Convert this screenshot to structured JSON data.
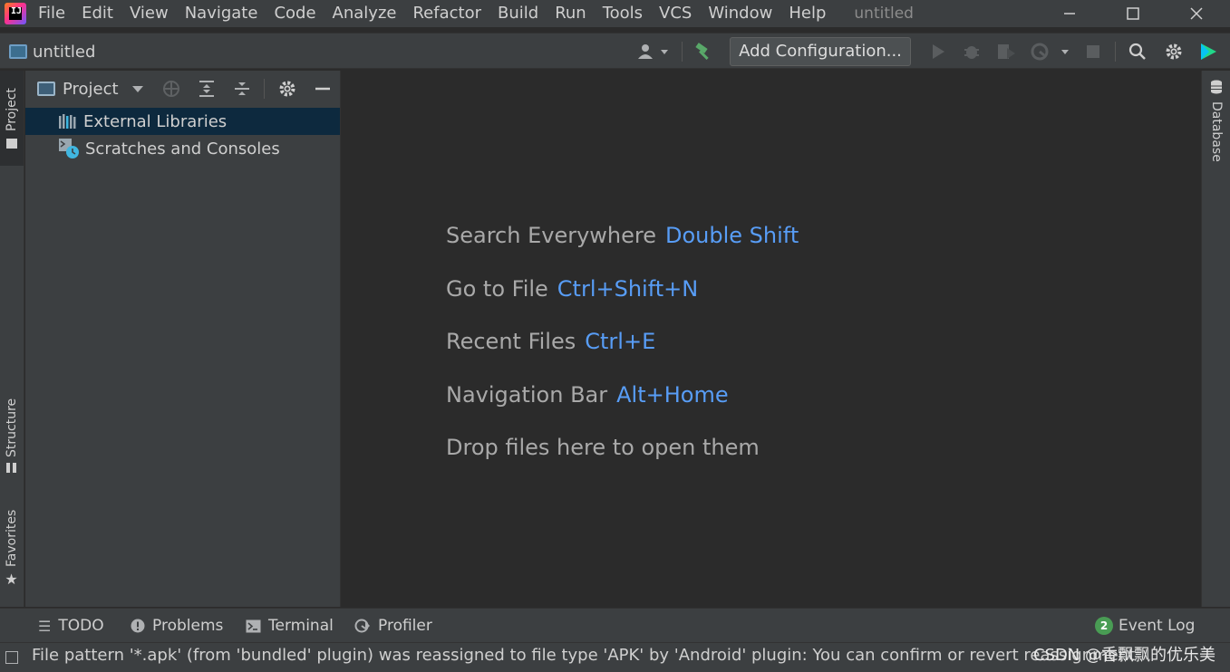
{
  "menubar": {
    "items": [
      "File",
      "Edit",
      "View",
      "Navigate",
      "Code",
      "Analyze",
      "Refactor",
      "Build",
      "Run",
      "Tools",
      "VCS",
      "Window",
      "Help"
    ],
    "window_title": "untitled"
  },
  "navbar": {
    "breadcrumb": "untitled",
    "add_configuration_label": "Add Configuration...",
    "accent_color": "#589df6",
    "icons": [
      "user-icon",
      "hammer-icon",
      "run-icon",
      "debug-icon",
      "coverage-icon",
      "profile-icon",
      "stop-icon",
      "search-icon",
      "gear-icon",
      "plugin-icon"
    ]
  },
  "left_strip": {
    "project_tab": "Project",
    "structure_tab": "Structure",
    "favorites_tab": "Favorites"
  },
  "project_panel": {
    "title": "Project",
    "tree": [
      {
        "label": "External Libraries",
        "icon": "library-icon",
        "selected": true
      },
      {
        "label": "Scratches and Consoles",
        "icon": "scratches-icon",
        "selected": false
      }
    ]
  },
  "editor": {
    "hints": [
      {
        "action": "Search Everywhere",
        "shortcut": "Double Shift"
      },
      {
        "action": "Go to File",
        "shortcut": "Ctrl+Shift+N"
      },
      {
        "action": "Recent Files",
        "shortcut": "Ctrl+E"
      },
      {
        "action": "Navigation Bar",
        "shortcut": "Alt+Home"
      }
    ],
    "drop_text": "Drop files here to open them"
  },
  "right_strip": {
    "database_tab": "Database"
  },
  "bottom_bar": {
    "tabs": [
      {
        "label": "TODO",
        "icon": "list-icon"
      },
      {
        "label": "Problems",
        "icon": "warning-icon"
      },
      {
        "label": "Terminal",
        "icon": "terminal-icon"
      },
      {
        "label": "Profiler",
        "icon": "profiler-icon"
      }
    ],
    "event_log": {
      "count": "2",
      "label": "Event Log"
    }
  },
  "status_bar": {
    "message": "File pattern '*.apk' (from 'bundled' plugin) was reassigned to file type 'APK' by 'Android' plugin: You can confirm or revert reassignment",
    "watermark": "CSDN @香飘飘的优乐美"
  }
}
